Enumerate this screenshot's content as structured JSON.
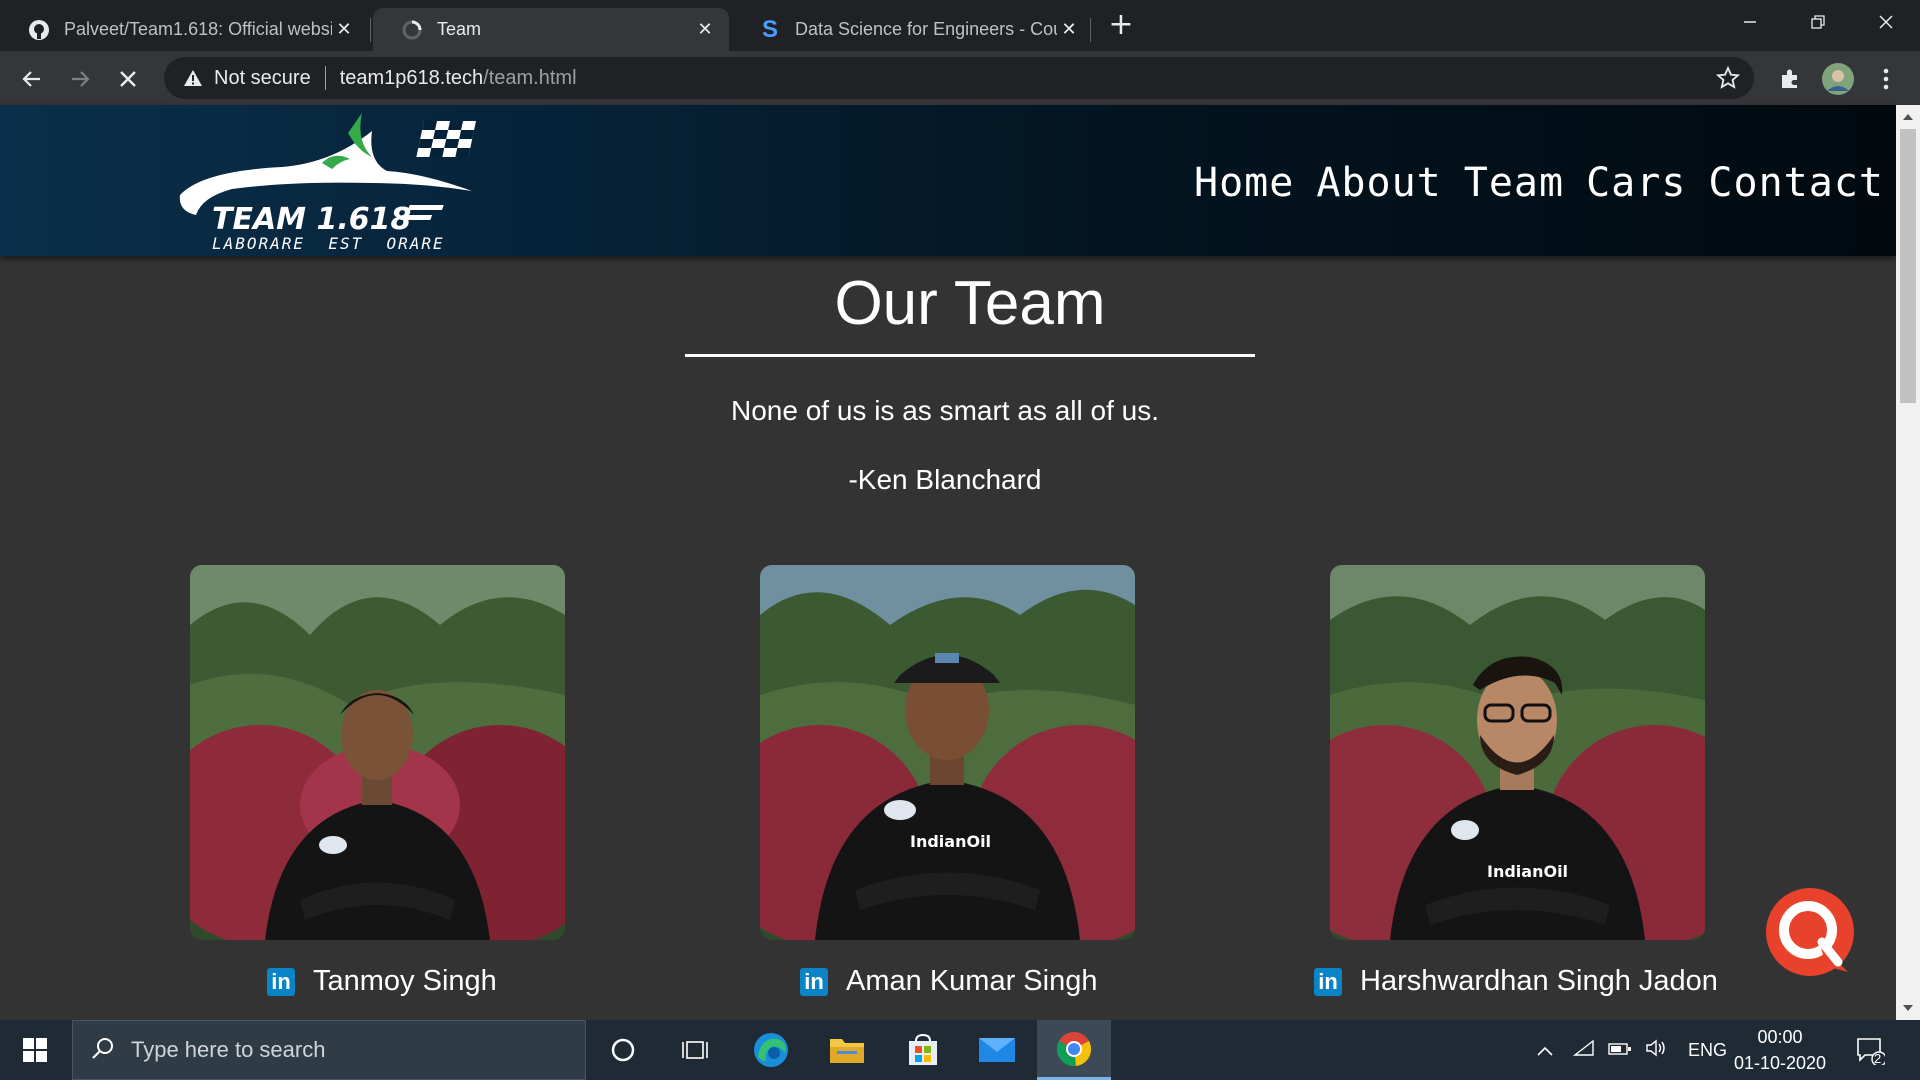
{
  "browser": {
    "tabs": [
      {
        "title": "Palveet/Team1.618: Official websi",
        "icon": "github-icon"
      },
      {
        "title": "Team",
        "icon": "loading-icon"
      },
      {
        "title": "Data Science for Engineers - Cou",
        "icon": "skillshare-s-icon"
      }
    ],
    "address": {
      "security": "Not secure",
      "host": "team1p618.tech",
      "path": "/team.html"
    }
  },
  "site": {
    "logo": {
      "main": "TEAM 1.618",
      "motto": "LABORARE  EST  ORARE"
    },
    "nav": [
      "Home",
      "About",
      "Team",
      "Cars",
      "Contact"
    ],
    "heading": "Our Team",
    "quote": "None of us is as smart as all of us.",
    "author": "-Ken Blanchard",
    "members": [
      {
        "name": "Tanmoy Singh",
        "shirt_text": ""
      },
      {
        "name": "Aman Kumar Singh",
        "shirt_text": "IndianOil"
      },
      {
        "name": "Harshwardhan Singh Jadon",
        "shirt_text": "IndianOil"
      }
    ],
    "linkedin_label": "in"
  },
  "taskbar": {
    "search_placeholder": "Type here to search",
    "language": "ENG",
    "time": "00:00",
    "date": "01-10-2020",
    "notification_count": "2"
  },
  "colors": {
    "page_bg": "#333333",
    "header_dark": "#031420",
    "linkedin": "#0a84c6",
    "chat": "#e8412c"
  }
}
